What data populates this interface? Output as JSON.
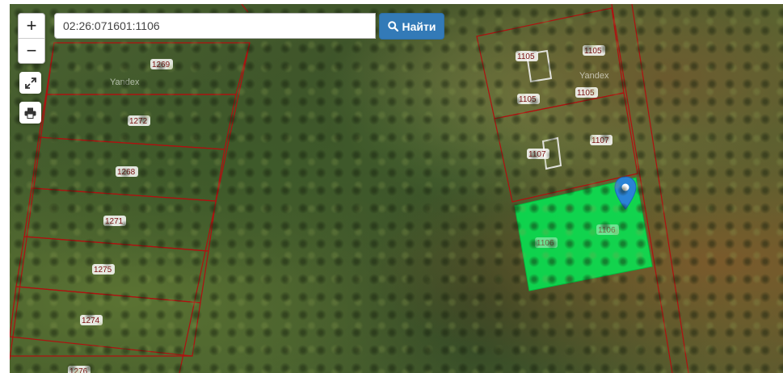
{
  "map": {
    "watermark": "Yandex",
    "highlight_color": "#00ee55",
    "boundary_color": "#b01010",
    "plots": [
      {
        "label": "1269"
      },
      {
        "label": "1272"
      },
      {
        "label": "1268"
      },
      {
        "label": "1271"
      },
      {
        "label": "1275"
      },
      {
        "label": "1274"
      },
      {
        "label": "1276"
      },
      {
        "label": "1105"
      },
      {
        "label": "1105"
      },
      {
        "label": "1105"
      },
      {
        "label": "1105"
      },
      {
        "label": "1107"
      },
      {
        "label": "1107"
      },
      {
        "label": "1106"
      },
      {
        "label": "1106"
      }
    ]
  },
  "controls": {
    "zoom_in": "+",
    "zoom_out": "−",
    "fullscreen_icon": "expand-icon",
    "print_icon": "printer-icon"
  },
  "search": {
    "value": "02:26:071601:1106",
    "button_label": "Найти",
    "button_icon": "search-icon",
    "button_color": "#337ab7"
  }
}
